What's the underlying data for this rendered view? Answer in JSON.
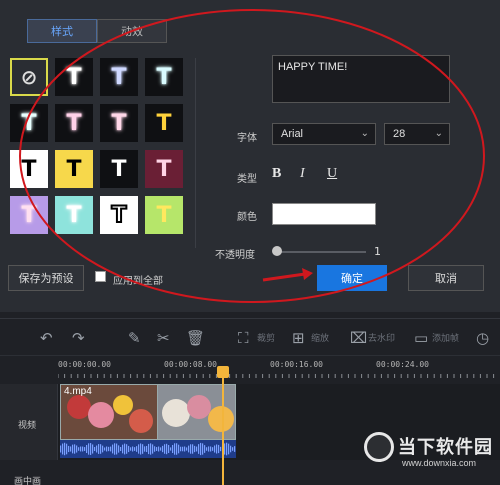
{
  "tabs": [
    {
      "label": "样式"
    },
    {
      "label": "动效"
    }
  ],
  "preset_grid": {
    "glyph": "T",
    "items": [
      {
        "style": "none",
        "bg": "#2a2d33",
        "fg": "#cccccc"
      },
      {
        "style": "outline",
        "bg": "#0f1013",
        "fg": "#ffffff"
      },
      {
        "style": "glow-blue",
        "bg": "#0f1013",
        "fg": "#cfd8ff"
      },
      {
        "style": "glow-cyan",
        "bg": "#0f1013",
        "fg": "#d9fbff"
      },
      {
        "style": "glow-cyan2",
        "bg": "#0f1013",
        "fg": "#e8ffff"
      },
      {
        "style": "glow-pink",
        "bg": "#0f1013",
        "fg": "#ffd1e8"
      },
      {
        "style": "glow-pink2",
        "bg": "#0f1013",
        "fg": "#ffd7e8"
      },
      {
        "style": "yellow",
        "bg": "#0f1013",
        "fg": "#ffd23b"
      },
      {
        "style": "black-on-white",
        "bg": "#ffffff",
        "fg": "#000000"
      },
      {
        "style": "black-on-yellow",
        "bg": "#f7d84b",
        "fg": "#000000"
      },
      {
        "style": "white-on-black",
        "bg": "#0f1013",
        "fg": "#ffffff"
      },
      {
        "style": "pink-on-maroon",
        "bg": "#6a1f35",
        "fg": "#ffd4e6"
      },
      {
        "style": "pink-outline-lilac",
        "bg": "#b79be8",
        "fg": "#ffe0f0"
      },
      {
        "style": "teal-outline-mint",
        "bg": "#8ee3dc",
        "fg": "#ffffff"
      },
      {
        "style": "outline-on-white",
        "bg": "#ffffff",
        "fg": "#ffffff"
      },
      {
        "style": "yellow-on-lime",
        "bg": "#b6e66a",
        "fg": "#ffe85e"
      }
    ]
  },
  "text_value": "HAPPY TIME!",
  "font": {
    "label": "字体",
    "family": "Arial",
    "size": "28"
  },
  "type": {
    "label": "类型",
    "bold": "B",
    "italic": "I",
    "underline": "U"
  },
  "color": {
    "label": "颜色",
    "value": "#ffffff"
  },
  "opacity": {
    "label": "不透明度",
    "value": "1",
    "fraction": 0.0
  },
  "buttons": {
    "save_preset": "保存为预设",
    "apply_all": "应用到全部",
    "confirm": "确定",
    "cancel": "取消"
  },
  "toolbar": {
    "items": [
      "裁剪",
      "缩放",
      "去水印",
      "添加帧"
    ]
  },
  "ruler": {
    "labels": [
      "00:00:00.00",
      "00:00:08.00",
      "00:00:16.00",
      "00:00:24.00"
    ]
  },
  "timeline": {
    "track_label": "视频",
    "track2_label": "画中画",
    "clip_name": "4.mp4"
  },
  "watermark": {
    "title": "当下软件园",
    "url": "www.downxia.com"
  },
  "colors": {
    "accent": "#1976e0",
    "annotation": "#d0181e",
    "playhead": "#f3b53b"
  }
}
